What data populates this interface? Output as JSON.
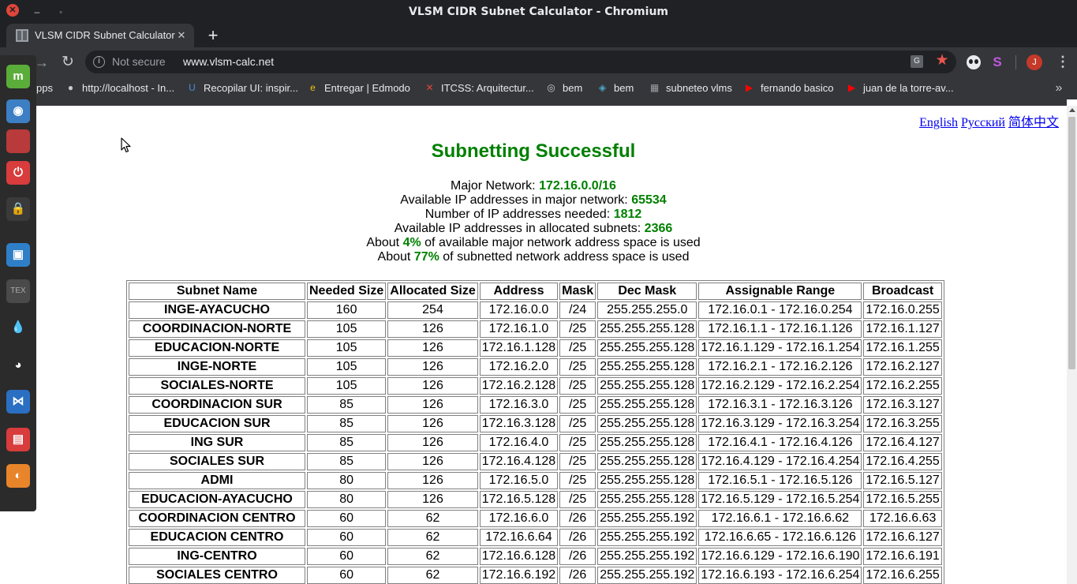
{
  "window": {
    "title": "VLSM CIDR Subnet Calculator - Chromium"
  },
  "tab": {
    "title": "VLSM CIDR Subnet Calculator"
  },
  "omnibox": {
    "security": "Not secure",
    "url": "www.vlsm-calc.net"
  },
  "avatar_letter": "J",
  "bookmarks": [
    {
      "label": "pps",
      "icon": "apps-icon"
    },
    {
      "label": "http://localhost - In...",
      "icon": "globe-icon"
    },
    {
      "label": "Recopilar UI: inspir...",
      "icon": "ui-icon"
    },
    {
      "label": "Entregar | Edmodo",
      "icon": "edmodo-icon"
    },
    {
      "label": "ITCSS: Arquitectur...",
      "icon": "itcss-icon"
    },
    {
      "label": "bem",
      "icon": "github-icon"
    },
    {
      "label": "bem",
      "icon": "bem-icon"
    },
    {
      "label": "subneteo vlms",
      "icon": "page-icon"
    },
    {
      "label": "fernando basico",
      "icon": "youtube-icon"
    },
    {
      "label": "juan de la torre-av...",
      "icon": "youtube-icon"
    }
  ],
  "languages": [
    "English",
    "Русский",
    "简体中文"
  ],
  "heading": "Subnetting Successful",
  "stats": {
    "major_label": "Major Network:",
    "major_value": "172.16.0.0/16",
    "avail_label": "Available IP addresses in major network:",
    "avail_value": "65534",
    "needed_label": "Number of IP addresses needed:",
    "needed_value": "1812",
    "alloc_label": "Available IP addresses in allocated subnets:",
    "alloc_value": "2366",
    "about1_pre": "About",
    "about1_value": "4%",
    "about1_post": "of available major network address space is used",
    "about2_pre": "About",
    "about2_value": "77%",
    "about2_post": "of subnetted network address space is used"
  },
  "table": {
    "columns": [
      "Subnet Name",
      "Needed Size",
      "Allocated Size",
      "Address",
      "Mask",
      "Dec Mask",
      "Assignable Range",
      "Broadcast"
    ],
    "rows": [
      [
        "INGE-AYACUCHO",
        "160",
        "254",
        "172.16.0.0",
        "/24",
        "255.255.255.0",
        "172.16.0.1 - 172.16.0.254",
        "172.16.0.255"
      ],
      [
        "COORDINACION-NORTE",
        "105",
        "126",
        "172.16.1.0",
        "/25",
        "255.255.255.128",
        "172.16.1.1 - 172.16.1.126",
        "172.16.1.127"
      ],
      [
        "EDUCACION-NORTE",
        "105",
        "126",
        "172.16.1.128",
        "/25",
        "255.255.255.128",
        "172.16.1.129 - 172.16.1.254",
        "172.16.1.255"
      ],
      [
        "INGE-NORTE",
        "105",
        "126",
        "172.16.2.0",
        "/25",
        "255.255.255.128",
        "172.16.2.1 - 172.16.2.126",
        "172.16.2.127"
      ],
      [
        "SOCIALES-NORTE",
        "105",
        "126",
        "172.16.2.128",
        "/25",
        "255.255.255.128",
        "172.16.2.129 - 172.16.2.254",
        "172.16.2.255"
      ],
      [
        "COORDINACION SUR",
        "85",
        "126",
        "172.16.3.0",
        "/25",
        "255.255.255.128",
        "172.16.3.1 - 172.16.3.126",
        "172.16.3.127"
      ],
      [
        "EDUCACION SUR",
        "85",
        "126",
        "172.16.3.128",
        "/25",
        "255.255.255.128",
        "172.16.3.129 - 172.16.3.254",
        "172.16.3.255"
      ],
      [
        "ING SUR",
        "85",
        "126",
        "172.16.4.0",
        "/25",
        "255.255.255.128",
        "172.16.4.1 - 172.16.4.126",
        "172.16.4.127"
      ],
      [
        "SOCIALES SUR",
        "85",
        "126",
        "172.16.4.128",
        "/25",
        "255.255.255.128",
        "172.16.4.129 - 172.16.4.254",
        "172.16.4.255"
      ],
      [
        "ADMI",
        "80",
        "126",
        "172.16.5.0",
        "/25",
        "255.255.255.128",
        "172.16.5.1 - 172.16.5.126",
        "172.16.5.127"
      ],
      [
        "EDUCACION-AYACUCHO",
        "80",
        "126",
        "172.16.5.128",
        "/25",
        "255.255.255.128",
        "172.16.5.129 - 172.16.5.254",
        "172.16.5.255"
      ],
      [
        "COORDINACION CENTRO",
        "60",
        "62",
        "172.16.6.0",
        "/26",
        "255.255.255.192",
        "172.16.6.1 - 172.16.6.62",
        "172.16.6.63"
      ],
      [
        "EDUCACION CENTRO",
        "60",
        "62",
        "172.16.6.64",
        "/26",
        "255.255.255.192",
        "172.16.6.65 - 172.16.6.126",
        "172.16.6.127"
      ],
      [
        "ING-CENTRO",
        "60",
        "62",
        "172.16.6.128",
        "/26",
        "255.255.255.192",
        "172.16.6.129 - 172.16.6.190",
        "172.16.6.191"
      ],
      [
        "SOCIALES CENTRO",
        "60",
        "62",
        "172.16.6.192",
        "/26",
        "255.255.255.192",
        "172.16.6.193 - 172.16.6.254",
        "172.16.6.255"
      ]
    ]
  },
  "dock": [
    {
      "name": "mint-menu-icon",
      "color": "#5bad3a",
      "glyph": "m"
    },
    {
      "name": "chromium-dock-icon",
      "color": "#3d7fc4",
      "glyph": "◉"
    },
    {
      "name": "files-dock-icon",
      "color": "#b83a3a",
      "glyph": ""
    },
    {
      "name": "power-icon",
      "color": "#d83c3c",
      "glyph": "⏻"
    },
    {
      "name": "lock-icon",
      "color": "#3a3a3a",
      "glyph": "🔒"
    },
    {
      "name": "screenshot-dock-icon",
      "color": "#2f7fc8",
      "glyph": "▣"
    },
    {
      "name": "tex-dock-icon",
      "color": "#4a4a4a",
      "glyph": "TEX"
    },
    {
      "name": "drop-dock-icon",
      "color": "#2b2b2b",
      "glyph": "💧"
    },
    {
      "name": "raccoon-dock-icon",
      "color": "#2b2b2b",
      "glyph": "◕"
    },
    {
      "name": "vscode-dock-icon",
      "color": "#2a6fc2",
      "glyph": "⋈"
    },
    {
      "name": "anydesk-dock-icon",
      "color": "#d83c3c",
      "glyph": "▤"
    },
    {
      "name": "firefox-dock-icon",
      "color": "#e8852a",
      "glyph": "◐"
    }
  ]
}
